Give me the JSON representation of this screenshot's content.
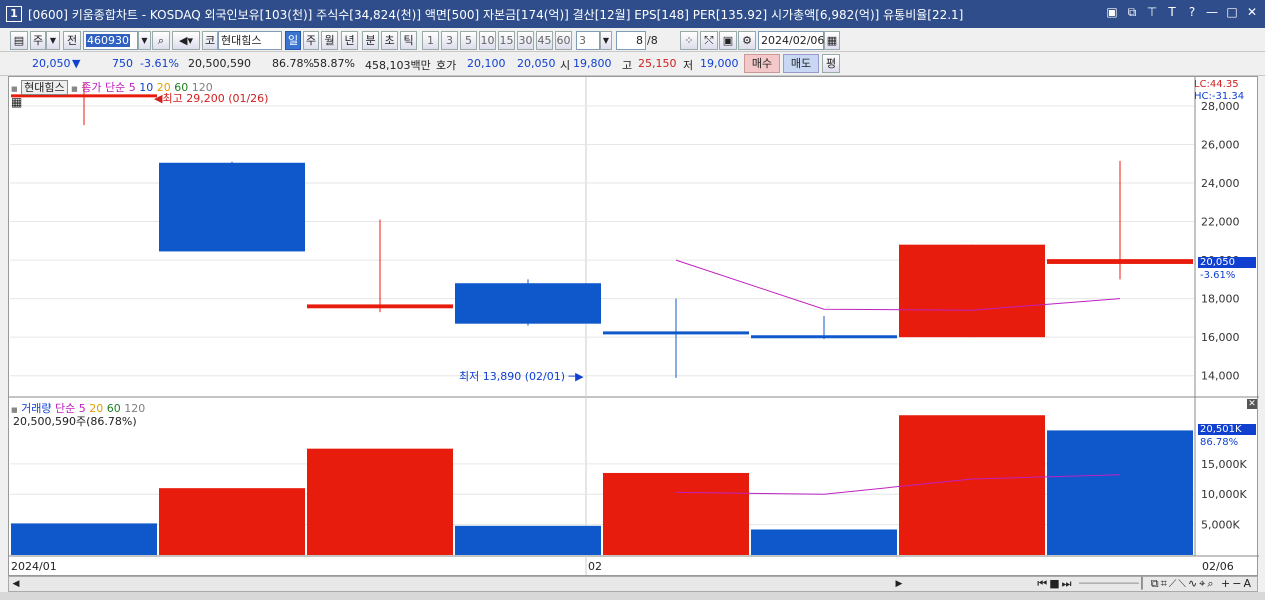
{
  "window": {
    "number": "1",
    "title": "[0600] 키움종합차트 - KOSDAQ 외국인보유[103(천)] 주식수[34,824(천)] 액면[500] 자본금[174(억)] 결산[12월] EPS[148] PER[135.92] 시가총액[6,982(억)] 유통비율[22.1]",
    "controls": [
      "▣",
      "⧉",
      "⊤",
      "T",
      "?",
      "—",
      "□",
      "✕"
    ]
  },
  "toolbar": {
    "period_select": "주",
    "adj_label": "전",
    "code": "460930",
    "stock_type": "코",
    "stock_name": "현대힘스",
    "periods": [
      "일",
      "주",
      "월",
      "년",
      "분",
      "초",
      "틱"
    ],
    "active_period": "일",
    "intervals": [
      "1",
      "3",
      "5",
      "10",
      "15",
      "30",
      "45",
      "60"
    ],
    "interval_value": "3",
    "count": "8",
    "count_total": "/8",
    "date": "2024/02/06"
  },
  "quote": {
    "price": "20,050",
    "direction": "▼",
    "change": "750",
    "change_pct": "-3.61%",
    "volume": "20,500,590",
    "vol_ratio": "86.78%",
    "turnover": "58.87%",
    "amount": "458,103백만",
    "ask_label": "호가",
    "ask": "20,100",
    "bid": "20,050",
    "open_label": "시",
    "open": "19,800",
    "high_label": "고",
    "high": "25,150",
    "low_label": "저",
    "low": "19,000",
    "buy_label": "매수",
    "sell_label": "매도",
    "eval_label": "평"
  },
  "chart_legend": {
    "stock_name": "현대힘스",
    "ma_label": "종가 단순",
    "ma_periods": [
      "5",
      "10",
      "20",
      "60",
      "120"
    ],
    "ma_colors": [
      "#c020c0",
      "#1040d0",
      "#e0a000",
      "#208020",
      "#808080"
    ],
    "high_note": "최고 29,200 (01/26)",
    "low_note": "최저 13,890 (02/01)",
    "lc": "LC:44.35",
    "hc": "HC:-31.34",
    "vol_label": "거래량",
    "vol_ma_label": "단순",
    "vol_ma_periods": [
      "5",
      "20",
      "60",
      "120"
    ],
    "vol_info": "20,500,590주(86.78%)",
    "price_tag": "20,050",
    "price_tag_pct": "-3.61%",
    "vol_tag": "20,501K",
    "vol_tag_pct": "86.78%",
    "date_labels": [
      "2024/01",
      "02",
      "02/06"
    ]
  },
  "chart_data": {
    "type": "bar",
    "price_axis": {
      "ticks": [
        "28,000",
        "26,000",
        "24,000",
        "22,000",
        "20,000",
        "18,000",
        "16,000",
        "14,000"
      ],
      "ylim": [
        13000,
        29500
      ]
    },
    "volume_axis": {
      "ticks": [
        "15,000K",
        "10,000K",
        "5,000K"
      ],
      "ylim": [
        0,
        26000
      ]
    },
    "candles": [
      {
        "open": 28500,
        "close": 28600,
        "high": 29200,
        "low": 27000,
        "color": "red"
      },
      {
        "open": 25050,
        "close": 20450,
        "high": 25100,
        "low": 20450,
        "color": "blue"
      },
      {
        "open": 17500,
        "close": 17700,
        "high": 22100,
        "low": 17300,
        "color": "red"
      },
      {
        "open": 18800,
        "close": 16700,
        "high": 19000,
        "low": 16600,
        "color": "blue"
      },
      {
        "open": 16300,
        "close": 16200,
        "high": 18000,
        "low": 13890,
        "color": "blue"
      },
      {
        "open": 16100,
        "close": 15950,
        "high": 17100,
        "low": 15900,
        "color": "blue"
      },
      {
        "open": 16000,
        "close": 20800,
        "high": 20800,
        "low": 16000,
        "color": "red"
      },
      {
        "open": 19800,
        "close": 20050,
        "high": 25150,
        "low": 19000,
        "color": "red"
      }
    ],
    "ma5": [
      null,
      null,
      null,
      null,
      20000,
      17450,
      17400,
      18000
    ],
    "volume": [
      5200,
      11000,
      17500,
      4800,
      13500,
      4200,
      23000,
      20500
    ],
    "vol_colors": [
      "blue",
      "red",
      "red",
      "blue",
      "red",
      "blue",
      "red",
      "blue"
    ],
    "vol_ma5": [
      null,
      null,
      null,
      null,
      10300,
      10000,
      12500,
      13200
    ]
  }
}
